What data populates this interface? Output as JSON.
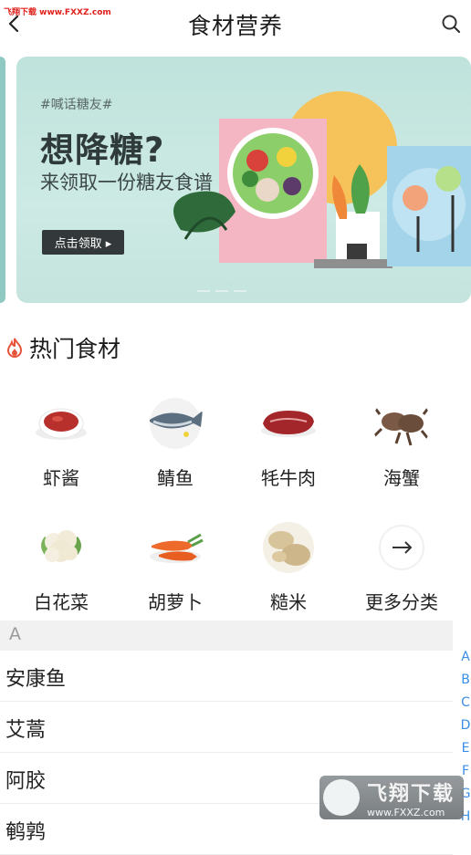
{
  "watermark_text": "飞翔下载 www.FXXZ.com",
  "header": {
    "title": "食材营养"
  },
  "banner": {
    "tag": "#喊话糖友#",
    "headline": "想降糖?",
    "subline": "来领取一份糖友食谱",
    "cta": "点击领取 ▸"
  },
  "hot_section": {
    "title": "热门食材"
  },
  "hot_items": [
    {
      "label": "虾酱"
    },
    {
      "label": "鲭鱼"
    },
    {
      "label": "牦牛肉"
    },
    {
      "label": "海蟹"
    },
    {
      "label": "白花菜"
    },
    {
      "label": "胡萝卜"
    },
    {
      "label": "糙米"
    },
    {
      "label": "更多分类"
    }
  ],
  "list": {
    "section_letter": "A",
    "items": [
      "安康鱼",
      "艾蒿",
      "阿胶",
      "鹌鹑"
    ]
  },
  "index_letters": [
    "A",
    "B",
    "C",
    "D",
    "E",
    "F",
    "G",
    "H"
  ],
  "logo_watermark": {
    "name": "飞翔下载",
    "url": "www.FXXZ.com"
  },
  "colors": {
    "accent_blue": "#3a8ee6",
    "banner_bg": "#c5e4de",
    "fire": "#e8533b"
  }
}
